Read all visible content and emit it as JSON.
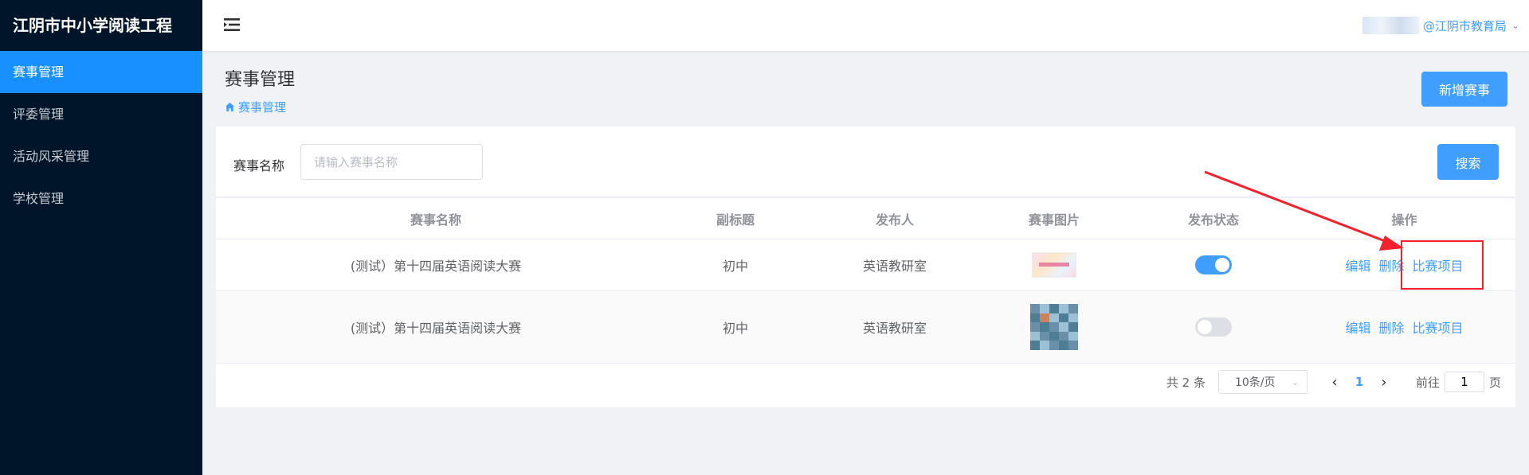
{
  "app": {
    "title": "江阴市中小学阅读工程"
  },
  "sidebar": {
    "items": [
      {
        "label": "赛事管理"
      },
      {
        "label": "评委管理"
      },
      {
        "label": "活动风采管理"
      },
      {
        "label": "学校管理"
      }
    ]
  },
  "header": {
    "user_label": "@江阴市教育局"
  },
  "page": {
    "title": "赛事管理",
    "breadcrumb": "赛事管理",
    "add_button": "新增赛事"
  },
  "search": {
    "label": "赛事名称",
    "placeholder": "请输入赛事名称",
    "button": "搜索"
  },
  "table": {
    "columns": [
      "赛事名称",
      "副标题",
      "发布人",
      "赛事图片",
      "发布状态",
      "操作"
    ],
    "rows": [
      {
        "name": "(测试）第十四届英语阅读大赛",
        "subtitle": "初中",
        "publisher": "英语教研室",
        "published": true
      },
      {
        "name": "(测试）第十四届英语阅读大赛",
        "subtitle": "初中",
        "publisher": "英语教研室",
        "published": false
      }
    ],
    "actions": {
      "edit": "编辑",
      "delete": "删除",
      "items": "比赛项目"
    }
  },
  "pagination": {
    "total": "共 2 条",
    "page_size": "10条/页",
    "current_page": "1",
    "goto_label": "前往",
    "goto_value": "1",
    "page_suffix": "页"
  },
  "colors": {
    "sidebar_bg": "#001529",
    "active": "#1890ff",
    "primary": "#409eff",
    "annotation": "#f5222d"
  }
}
